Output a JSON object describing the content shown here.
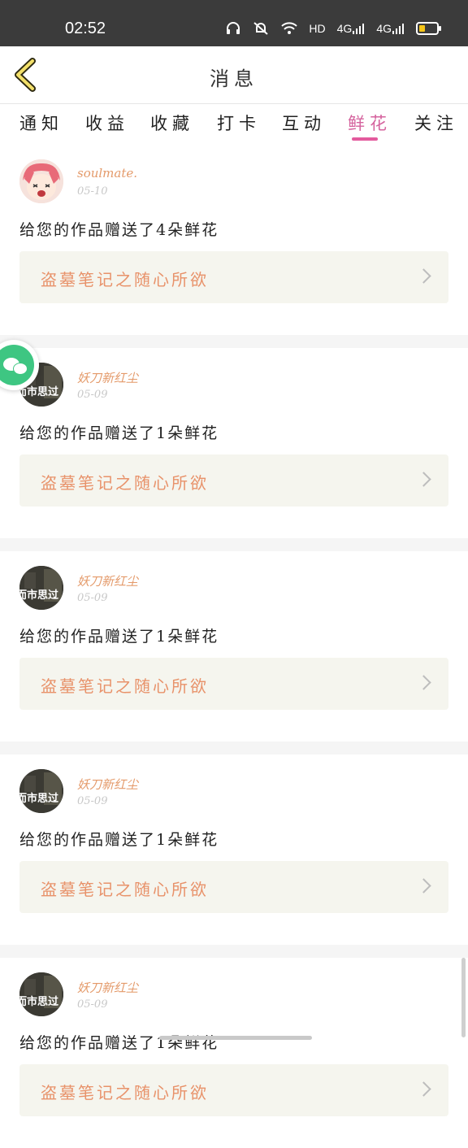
{
  "status_bar": {
    "time": "02:52",
    "network_label": "HD",
    "signal_1": "4G",
    "signal_2": "4G",
    "icons": [
      "headphones-icon",
      "mute-bell-icon",
      "wifi-icon",
      "signal-icon",
      "battery-icon"
    ],
    "battery_level": 0.3
  },
  "header": {
    "title": "消息",
    "back_icon": "chevron-left-icon"
  },
  "tabs": [
    {
      "label": "通知"
    },
    {
      "label": "收益"
    },
    {
      "label": "收藏"
    },
    {
      "label": "打卡"
    },
    {
      "label": "互动"
    },
    {
      "label": "鲜花",
      "active": true
    },
    {
      "label": "关注"
    }
  ],
  "messages": [
    {
      "user": "soulmate.",
      "date": "05-10",
      "text": "给您的作品赠送了4朵鲜花",
      "work": "盗墓笔记之随心所欲",
      "avatar": "anime"
    },
    {
      "user": "妖刀新红尘",
      "date": "05-09",
      "text": "给您的作品赠送了1朵鲜花",
      "work": "盗墓笔记之随心所欲",
      "avatar": "photo",
      "avatar_text": "而市思过"
    },
    {
      "user": "妖刀新红尘",
      "date": "05-09",
      "text": "给您的作品赠送了1朵鲜花",
      "work": "盗墓笔记之随心所欲",
      "avatar": "photo",
      "avatar_text": "而市思过"
    },
    {
      "user": "妖刀新红尘",
      "date": "05-09",
      "text": "给您的作品赠送了1朵鲜花",
      "work": "盗墓笔记之随心所欲",
      "avatar": "photo",
      "avatar_text": "而市思过"
    },
    {
      "user": "妖刀新红尘",
      "date": "05-09",
      "text": "给您的作品赠送了1朵鲜花",
      "work": "盗墓笔记之随心所欲",
      "avatar": "photo",
      "avatar_text": "而市思过"
    }
  ],
  "colors": {
    "accent_pink": "#e35a9d",
    "user_name": "#e49a6a",
    "work_title": "#e8926a",
    "card_bg": "#f5f5ee",
    "wechat_green": "#3ec682"
  }
}
